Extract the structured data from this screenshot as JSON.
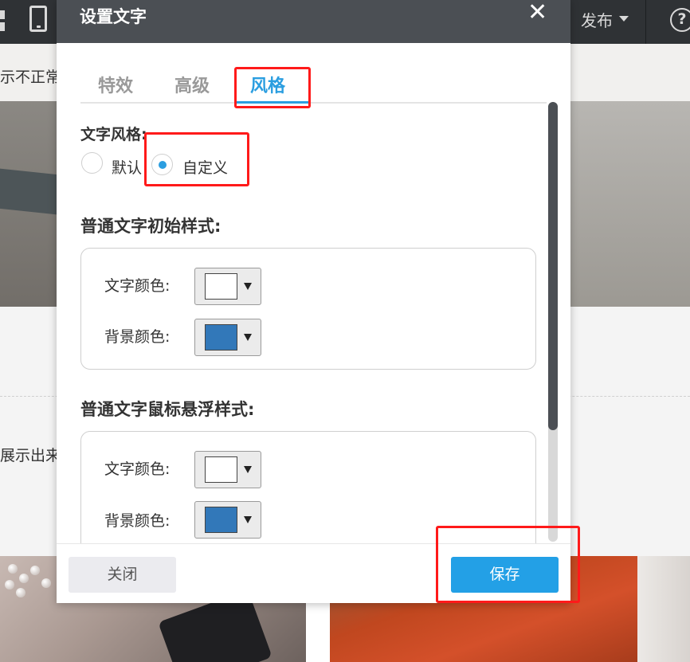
{
  "topbar": {
    "publish_label": "发布",
    "help_label": "?"
  },
  "background": {
    "notice_text": "示不正常",
    "mid_text": "展示出来"
  },
  "modal": {
    "title": "设置文字",
    "close_glyph": "✕",
    "tabs": [
      {
        "label": "特效",
        "active": false
      },
      {
        "label": "高级",
        "active": false
      },
      {
        "label": "风格",
        "active": true
      }
    ],
    "text_style": {
      "label": "文字风格:",
      "options": [
        {
          "label": "默认",
          "selected": false
        },
        {
          "label": "自定义",
          "selected": true
        }
      ]
    },
    "normal_section": {
      "title": "普通文字初始样式:",
      "text_color_label": "文字颜色:",
      "text_color": "#ffffff",
      "bg_color_label": "背景颜色:",
      "bg_color": "#3278b9"
    },
    "hover_section": {
      "title": "普通文字鼠标悬浮样式:",
      "text_color_label": "文字颜色:",
      "text_color": "#ffffff",
      "bg_color_label": "背景颜色:",
      "bg_color": "#3278b9"
    },
    "footer": {
      "close_label": "关闭",
      "save_label": "保存"
    }
  },
  "colors": {
    "accent": "#2b9ee0",
    "highlight": "#ff1a1a",
    "header_bg": "#4b4f54"
  }
}
